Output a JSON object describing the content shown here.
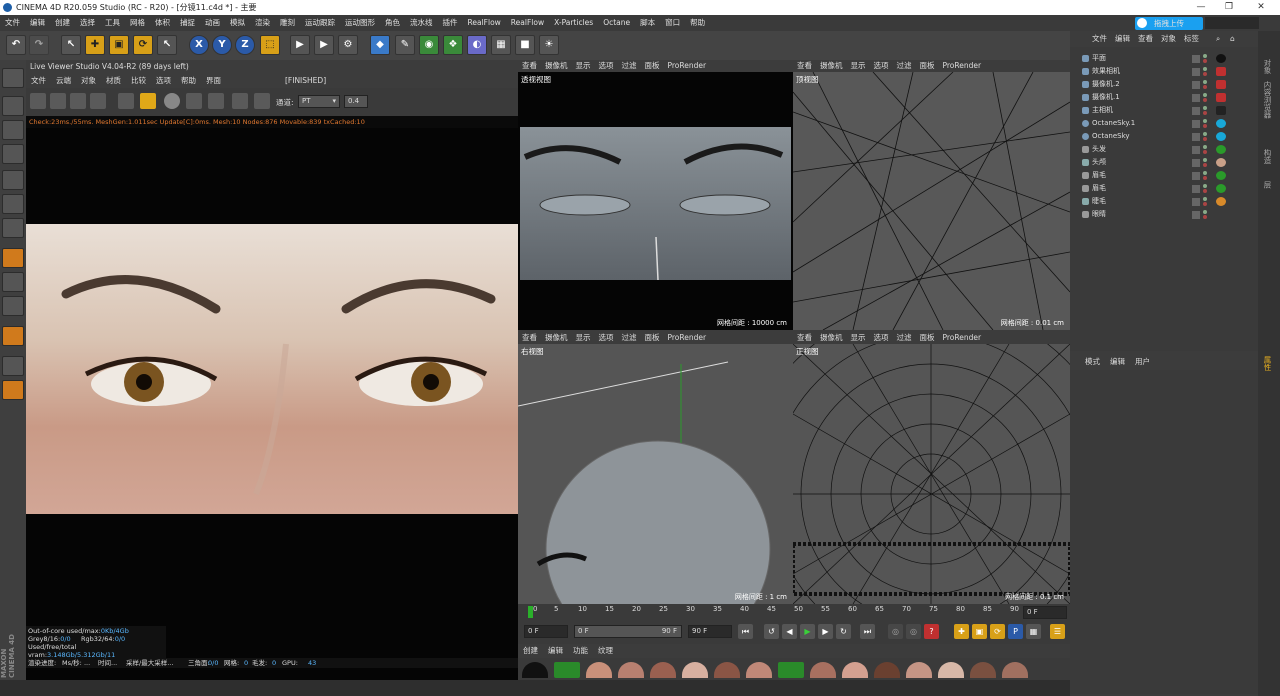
{
  "window": {
    "title": "CINEMA 4D R20.059 Studio (RC - R20) - [分镜11.c4d *] - 主要"
  },
  "menubar": {
    "items": [
      "文件",
      "编辑",
      "创建",
      "选择",
      "工具",
      "网格",
      "体积",
      "捕捉",
      "动画",
      "模拟",
      "渲染",
      "雕刻",
      "运动跟踪",
      "运动图形",
      "角色",
      "流水线",
      "插件",
      "RealFlow",
      "RealFlow",
      "X-Particles",
      "Octane",
      "脚本",
      "窗口",
      "帮助"
    ]
  },
  "upload_button": "拖拽上传",
  "toolbar": {
    "icons": [
      "undo-icon",
      "redo-icon",
      "live-select-icon",
      "move-icon",
      "scale-icon",
      "rotate-icon",
      "select-icon",
      "x-axis-icon",
      "y-axis-icon",
      "z-axis-icon",
      "coordinate-icon",
      "render-view-icon",
      "render-picture-icon",
      "render-settings-icon",
      "cube-icon",
      "pen-icon",
      "subdivision-icon",
      "array-icon",
      "deformer-icon",
      "scene-icon",
      "camera-icon",
      "light-icon"
    ],
    "axis_labels": [
      "X",
      "Y",
      "Z"
    ]
  },
  "live_viewer": {
    "title": "Live Viewer Studio V4.04-R2 (89 days left)",
    "menu": [
      "文件",
      "云端",
      "对象",
      "材质",
      "比较",
      "选项",
      "帮助",
      "界面"
    ],
    "state": "[FINISHED]",
    "channel_label": "通道:",
    "channel_value": "PT",
    "value_field": "0.4",
    "status": "Check:23ms./55ms. MeshGen:1.011sec Update[C]:0ms. Mesh:10 Nodes:876 Movable:839 txCached:10",
    "info": [
      {
        "label": "Out-of-core used/max:",
        "value": "0Kb/4Gb"
      },
      {
        "label": "Grey8/16:",
        "value": "0/0",
        "label2": "Rgb32/64:",
        "value2": "0/0"
      },
      {
        "label": "Used/free/total vram:",
        "value": "3.148Gb/5.312Gb/11"
      }
    ],
    "bottom": {
      "progress_label": "渲染进度:",
      "ms": "Ms/秒: ...",
      "time": "时间...",
      "sample": "采样/最大采样...",
      "tri_label": "三角面:",
      "tri": "0/0",
      "mesh_label": "网格:",
      "mesh": "0",
      "hair_label": "毛发:",
      "hair": "0",
      "gpu_label": "GPU:",
      "gpu": "43"
    }
  },
  "viewport_menu": [
    "查看",
    "摄像机",
    "显示",
    "选项",
    "过滤",
    "面板",
    "ProRender"
  ],
  "viewports": [
    {
      "name": "透视视图",
      "grid": "网格间距 : 10000 cm"
    },
    {
      "name": "顶视图",
      "grid": "网格间距 : 0.01 cm"
    },
    {
      "name": "右视图",
      "grid": "网格间距 : 1 cm"
    },
    {
      "name": "正视图",
      "grid": "网格间距 : 0.1 cm"
    }
  ],
  "object_manager": {
    "menu": [
      "文件",
      "编辑",
      "查看",
      "对象",
      "标签"
    ],
    "objects": [
      "平面",
      "效果相机",
      "摄像机.2",
      "摄像机.1",
      "主相机",
      "OctaneSky.1",
      "OctaneSky",
      "头发",
      "头颅",
      "眉毛",
      "眉毛",
      "睫毛",
      "眼睛"
    ]
  },
  "attribute_manager": {
    "menu": [
      "模式",
      "编辑",
      "用户"
    ]
  },
  "right_tabs": [
    "对象",
    "内容浏览器",
    "构造",
    "层",
    "属性"
  ],
  "timeline": {
    "ticks": [
      "0",
      "5",
      "10",
      "15",
      "20",
      "25",
      "30",
      "35",
      "40",
      "45",
      "50",
      "55",
      "60",
      "65",
      "70",
      "75",
      "80",
      "85",
      "90"
    ],
    "end_field": "0 F"
  },
  "transport": {
    "current": "0 F",
    "start": "0 F",
    "range_end": "90 F",
    "end": "90 F"
  },
  "material_manager": {
    "menu": [
      "创建",
      "编辑",
      "功能",
      "纹理"
    ]
  },
  "maxon_logo": "MAXON CINEMA 4D"
}
